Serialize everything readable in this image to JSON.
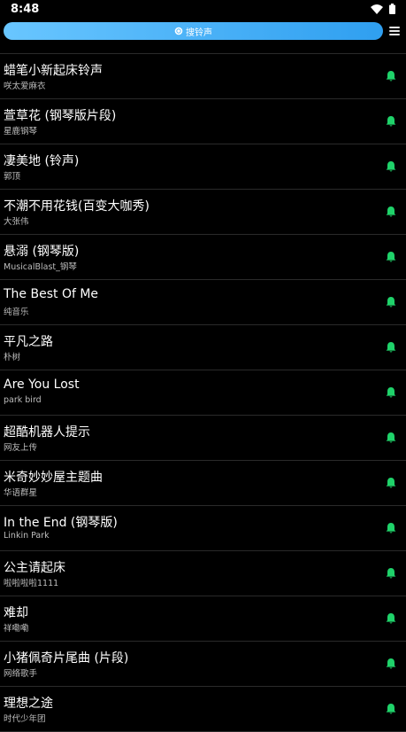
{
  "status_bar": {
    "time": "8:48"
  },
  "search": {
    "label": "搜铃声"
  },
  "colors": {
    "accent": "#2f9ff0",
    "bell": "#1fd26a"
  },
  "songs": [
    {
      "title": "蜡笔小新起床铃声",
      "artist": "咲太爱麻衣"
    },
    {
      "title": "萱草花 (钢琴版片段)",
      "artist": "星鹿钢琴"
    },
    {
      "title": "凄美地 (铃声)",
      "artist": "郭顶"
    },
    {
      "title": "不潮不用花钱(百变大咖秀)",
      "artist": "大张伟"
    },
    {
      "title": "悬溺 (钢琴版)",
      "artist": "MusicalBlast_钢琴"
    },
    {
      "title": "The Best Of Me",
      "artist": "纯音乐"
    },
    {
      "title": "平凡之路",
      "artist": "朴树"
    },
    {
      "title": "Are You Lost",
      "artist": "park bird"
    },
    {
      "title": "超酷机器人提示",
      "artist": "网友上传"
    },
    {
      "title": "米奇妙妙屋主题曲",
      "artist": "华语群星"
    },
    {
      "title": "In the End (钢琴版)",
      "artist": "Linkin Park"
    },
    {
      "title": "公主请起床",
      "artist": "啦啦啦啦1111"
    },
    {
      "title": "难却",
      "artist": "祥嘞嘞"
    },
    {
      "title": "小猪佩奇片尾曲 (片段)",
      "artist": "网络歌手"
    },
    {
      "title": "理想之途",
      "artist": "时代少年团"
    }
  ]
}
